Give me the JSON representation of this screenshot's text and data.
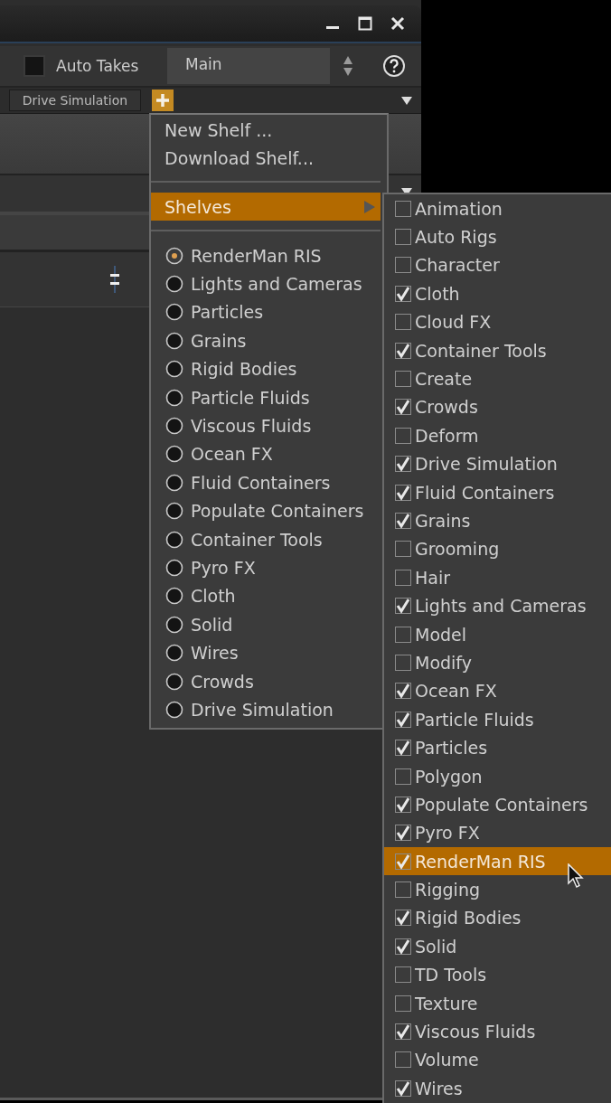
{
  "toolbar": {
    "auto_takes": {
      "label": "Auto Takes",
      "checked": false
    },
    "take": {
      "value": "Main"
    }
  },
  "shelf_tabs": [
    {
      "label": "Drive Simulation"
    }
  ],
  "menu": {
    "actions": [
      {
        "label": "New Shelf ..."
      },
      {
        "label": "Download Shelf..."
      }
    ],
    "submenu": {
      "label": "Shelves",
      "selected": true
    },
    "shelf_sets": [
      {
        "label": "RenderMan RIS",
        "selected": true
      },
      {
        "label": "Lights and Cameras",
        "selected": false
      },
      {
        "label": "Particles",
        "selected": false
      },
      {
        "label": "Grains",
        "selected": false
      },
      {
        "label": "Rigid Bodies",
        "selected": false
      },
      {
        "label": "Particle Fluids",
        "selected": false
      },
      {
        "label": "Viscous Fluids",
        "selected": false
      },
      {
        "label": "Ocean FX",
        "selected": false
      },
      {
        "label": "Fluid Containers",
        "selected": false
      },
      {
        "label": "Populate Containers",
        "selected": false
      },
      {
        "label": "Container Tools",
        "selected": false
      },
      {
        "label": "Pyro FX",
        "selected": false
      },
      {
        "label": "Cloth",
        "selected": false
      },
      {
        "label": "Solid",
        "selected": false
      },
      {
        "label": "Wires",
        "selected": false
      },
      {
        "label": "Crowds",
        "selected": false
      },
      {
        "label": "Drive Simulation",
        "selected": false
      }
    ]
  },
  "shelves": [
    {
      "label": "Animation",
      "checked": false,
      "selected": false
    },
    {
      "label": "Auto Rigs",
      "checked": false,
      "selected": false
    },
    {
      "label": "Character",
      "checked": false,
      "selected": false
    },
    {
      "label": "Cloth",
      "checked": true,
      "selected": false
    },
    {
      "label": "Cloud FX",
      "checked": false,
      "selected": false
    },
    {
      "label": "Container Tools",
      "checked": true,
      "selected": false
    },
    {
      "label": "Create",
      "checked": false,
      "selected": false
    },
    {
      "label": "Crowds",
      "checked": true,
      "selected": false
    },
    {
      "label": "Deform",
      "checked": false,
      "selected": false
    },
    {
      "label": "Drive Simulation",
      "checked": true,
      "selected": false
    },
    {
      "label": "Fluid Containers",
      "checked": true,
      "selected": false
    },
    {
      "label": "Grains",
      "checked": true,
      "selected": false
    },
    {
      "label": "Grooming",
      "checked": false,
      "selected": false
    },
    {
      "label": "Hair",
      "checked": false,
      "selected": false
    },
    {
      "label": "Lights and Cameras",
      "checked": true,
      "selected": false
    },
    {
      "label": "Model",
      "checked": false,
      "selected": false
    },
    {
      "label": "Modify",
      "checked": false,
      "selected": false
    },
    {
      "label": "Ocean FX",
      "checked": true,
      "selected": false
    },
    {
      "label": "Particle Fluids",
      "checked": true,
      "selected": false
    },
    {
      "label": "Particles",
      "checked": true,
      "selected": false
    },
    {
      "label": "Polygon",
      "checked": false,
      "selected": false
    },
    {
      "label": "Populate Containers",
      "checked": true,
      "selected": false
    },
    {
      "label": "Pyro FX",
      "checked": true,
      "selected": false
    },
    {
      "label": "RenderMan RIS",
      "checked": true,
      "selected": true
    },
    {
      "label": "Rigging",
      "checked": false,
      "selected": false
    },
    {
      "label": "Rigid Bodies",
      "checked": true,
      "selected": false
    },
    {
      "label": "Solid",
      "checked": true,
      "selected": false
    },
    {
      "label": "TD Tools",
      "checked": false,
      "selected": false
    },
    {
      "label": "Texture",
      "checked": false,
      "selected": false
    },
    {
      "label": "Viscous Fluids",
      "checked": true,
      "selected": false
    },
    {
      "label": "Volume",
      "checked": false,
      "selected": false
    },
    {
      "label": "Wires",
      "checked": true,
      "selected": false
    }
  ]
}
